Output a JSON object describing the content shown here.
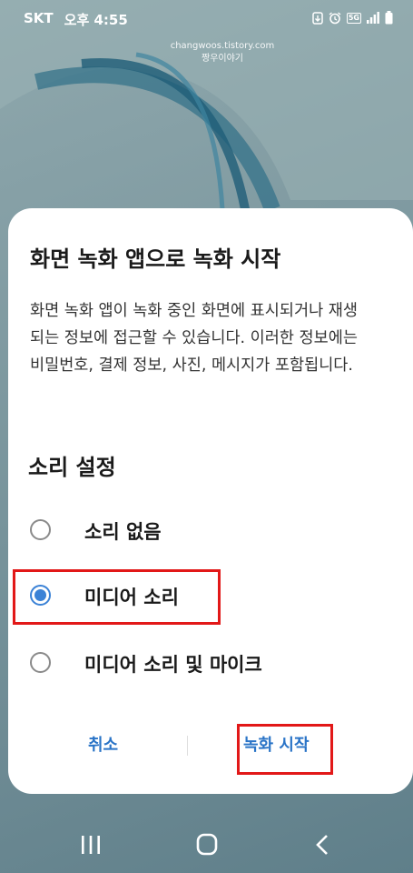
{
  "status_bar": {
    "carrier": "SKT",
    "time": "오후 4:55",
    "icons": [
      "download-icon",
      "alarm-icon",
      "5g-icon",
      "signal-icon",
      "battery-icon"
    ],
    "network_label": "5G"
  },
  "watermark": {
    "line1": "changwoos.tistory.com",
    "line2": "짱우이야기"
  },
  "dialog": {
    "title": "화면 녹화 앱으로 녹화 시작",
    "description": "화면 녹화 앱이 녹화 중인 화면에 표시되거나 재생되는 정보에 접근할 수 있습니다. 이러한 정보에는 비밀번호, 결제 정보, 사진, 메시지가 포함됩니다.",
    "section_title": "소리 설정",
    "options": [
      {
        "label": "소리 없음",
        "selected": false
      },
      {
        "label": "미디어 소리",
        "selected": true
      },
      {
        "label": "미디어 소리 및 마이크",
        "selected": false
      }
    ],
    "cancel_label": "취소",
    "start_label": "녹화 시작"
  },
  "nav_bar": {
    "icons": [
      "recent-apps-icon",
      "home-icon",
      "back-icon"
    ]
  },
  "colors": {
    "accent": "#3b82d6",
    "button_text": "#2a74c7",
    "highlight": "#e21818"
  }
}
